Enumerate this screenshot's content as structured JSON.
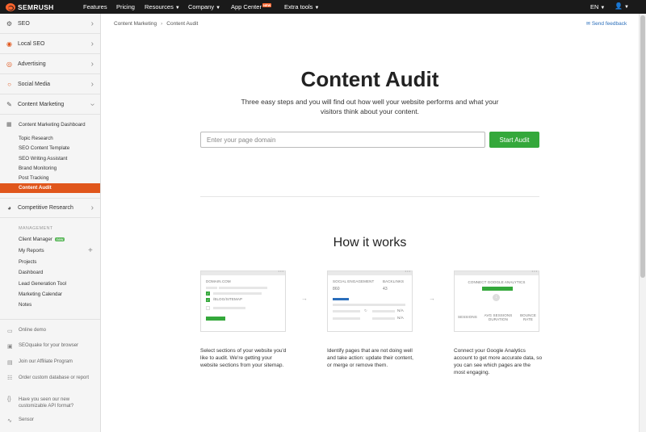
{
  "topbar": {
    "brand": "SEMRUSH",
    "nav": [
      {
        "label": "Features",
        "caret": false
      },
      {
        "label": "Pricing",
        "caret": false
      },
      {
        "label": "Resources",
        "caret": true
      },
      {
        "label": "Company",
        "caret": true
      },
      {
        "label": "App Center",
        "badge": "NEW"
      },
      {
        "label": "Extra tools",
        "caret": true
      }
    ],
    "language": "EN",
    "user_icon": "user-icon"
  },
  "sidebar": {
    "sections": [
      {
        "label": "SEO",
        "icon": "seo-icon"
      },
      {
        "label": "Local SEO",
        "icon": "pin-icon"
      },
      {
        "label": "Advertising",
        "icon": "target-icon"
      },
      {
        "label": "Social Media",
        "icon": "social-icon"
      },
      {
        "label": "Content Marketing",
        "icon": "pencil-icon"
      }
    ],
    "content_marketing_items": [
      "Content Marketing Dashboard",
      "Topic Research",
      "SEO Content Template",
      "SEO Writing Assistant",
      "Brand Monitoring",
      "Post Tracking",
      "Content Audit"
    ],
    "competitive": {
      "label": "Competitive Research",
      "icon": "competitive-icon"
    },
    "management_heading": "MANAGEMENT",
    "management_items": [
      {
        "label": "Client Manager",
        "badge": "new"
      },
      {
        "label": "My Reports"
      },
      {
        "label": "Projects"
      },
      {
        "label": "Dashboard"
      },
      {
        "label": "Lead Generation Tool"
      },
      {
        "label": "Marketing Calendar"
      },
      {
        "label": "Notes"
      }
    ],
    "promos": [
      {
        "label": "Online demo",
        "icon": "monitor-icon"
      },
      {
        "label": "SEOquake for your browser",
        "icon": "seoquake-icon"
      },
      {
        "label": "Join our Affiliate Program",
        "icon": "affiliate-icon"
      },
      {
        "label": "Order custom database or report",
        "icon": "database-icon"
      },
      {
        "label": "Have you seen our new customizable API format?",
        "icon": "api-icon"
      },
      {
        "label": "Sensor",
        "icon": "sensor-icon"
      }
    ]
  },
  "main": {
    "breadcrumb": [
      "Content Marketing",
      "Content Audit"
    ],
    "feedback": "Send feedback",
    "title": "Content Audit",
    "description": "Three easy steps and you will find out how well your website performs and what your visitors think about your content.",
    "input_placeholder": "Enter your page domain",
    "button_label": "Start Audit",
    "how_title": "How it works",
    "steps": [
      {
        "card": {
          "heading": "DOMAIN.COM",
          "path": "/BLOG/SITEMAP"
        },
        "text": "Select sections of your website you'd like to audit. We're getting your website sections from your sitemap."
      },
      {
        "card": {
          "col1": "SOCIAL ENGAGEMENT",
          "col2": "BACKLINKS",
          "val1": "860",
          "val2": "43",
          "na1": "N/A",
          "na2": "N/A"
        },
        "text": "Identify pages that are not doing well and take action: update their content, or merge or remove them."
      },
      {
        "card": {
          "heading": "CONNECT GOOGLE ANALYTICS",
          "m1": "SESSIONS",
          "m2": "AVG SESSIONS DURATION",
          "m3": "BOUNCE RATE"
        },
        "text": "Connect your Google Analytics account to get more accurate data, so you can see which pages are the most engaging."
      }
    ]
  },
  "colors": {
    "accent": "#e0561b",
    "green": "#34a83b",
    "topbar": "#1a1a1a",
    "link": "#2a6ebb"
  }
}
